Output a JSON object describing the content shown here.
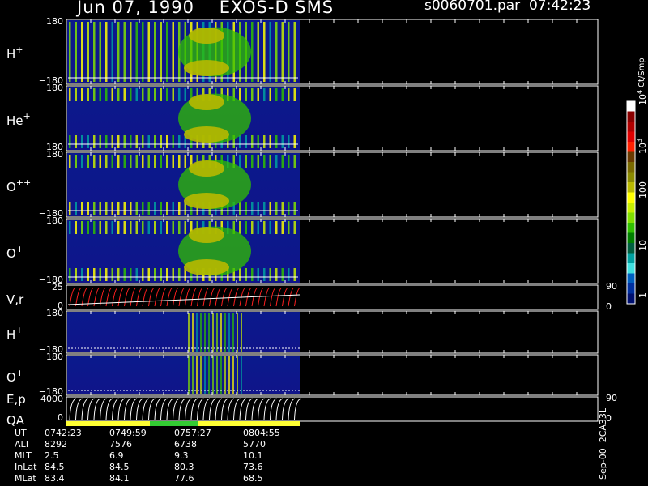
{
  "header": {
    "title": "Jun 07, 1990    EXOS-D SMS",
    "file": "s0060701.par  07:42:23"
  },
  "panels": [
    {
      "id": "h-plus-pitch",
      "label": "H",
      "sup": "+",
      "ytop": "180",
      "ybot": "−180"
    },
    {
      "id": "he-plus-pitch",
      "label": "He",
      "sup": "+",
      "ytop": "180",
      "ybot": "−180"
    },
    {
      "id": "o-pp-pitch",
      "label": "O",
      "sup": "++",
      "ytop": "180",
      "ybot": "−180"
    },
    {
      "id": "o-plus-pitch",
      "label": "O",
      "sup": "+",
      "ytop": "180",
      "ybot": "−180"
    },
    {
      "id": "vr-panel",
      "label": "V,r",
      "sup": "",
      "ytop": "25",
      "ybot": "0",
      "right_top": "90",
      "right_bot": "0"
    },
    {
      "id": "h-plus-2",
      "label": "H",
      "sup": "+",
      "ytop": "180",
      "ybot": "−180"
    },
    {
      "id": "o-plus-2",
      "label": "O",
      "sup": "+",
      "ytop": "180",
      "ybot": "−180"
    },
    {
      "id": "ep-panel",
      "label": "E,p",
      "sup": "",
      "ytop": "4000",
      "ybot": "0",
      "right_top": "90",
      "right_bot": "0"
    },
    {
      "id": "qa-panel",
      "label": "QA",
      "sup": "",
      "ytop": "",
      "ybot": ""
    }
  ],
  "colorbar": {
    "unit_label": "Ct/Smp",
    "ticks": [
      "1",
      "10",
      "100",
      "10",
      "10"
    ],
    "tick_sup": [
      "",
      "",
      "",
      "3",
      "4"
    ],
    "colors": [
      "#ffffff",
      "#8b0000",
      "#b00000",
      "#e00000",
      "#ff2000",
      "#6b3a00",
      "#7a6a00",
      "#8a8a00",
      "#b8b800",
      "#ffff00",
      "#c8f000",
      "#80e000",
      "#30c000",
      "#008000",
      "#006040",
      "#00a0a0",
      "#40e0e0",
      "#0060c0",
      "#0030a0",
      "#001070"
    ]
  },
  "qa_colors": [
    "#ffff33",
    "#33cc33",
    "#ffff33"
  ],
  "table": {
    "rows": [
      {
        "key": "UT",
        "vals": [
          "0742:23",
          "0749:59",
          "0757:27",
          "0804:55"
        ]
      },
      {
        "key": "ALT",
        "vals": [
          "8292",
          "7576",
          "6738",
          "5770"
        ]
      },
      {
        "key": "MLT",
        "vals": [
          "2.5",
          "6.9",
          "9.3",
          "10.1"
        ]
      },
      {
        "key": "InLat",
        "vals": [
          "84.5",
          "84.5",
          "80.3",
          "73.6"
        ]
      },
      {
        "key": "MLat",
        "vals": [
          "83.4",
          "84.1",
          "77.6",
          "68.5"
        ]
      }
    ]
  },
  "footer": "Sep-00  2CA33L",
  "chart_data": {
    "type": "heatmap",
    "title": "Jun 07, 1990    EXOS-D SMS",
    "x_ticks_ut": [
      "0742:23",
      "0749:59",
      "0757:27",
      "0804:55"
    ],
    "y_range_pitch": [
      -180,
      180
    ],
    "colorbar_range": [
      "1",
      "10^4"
    ],
    "colorbar_unit": "Ct/Smp"
  }
}
